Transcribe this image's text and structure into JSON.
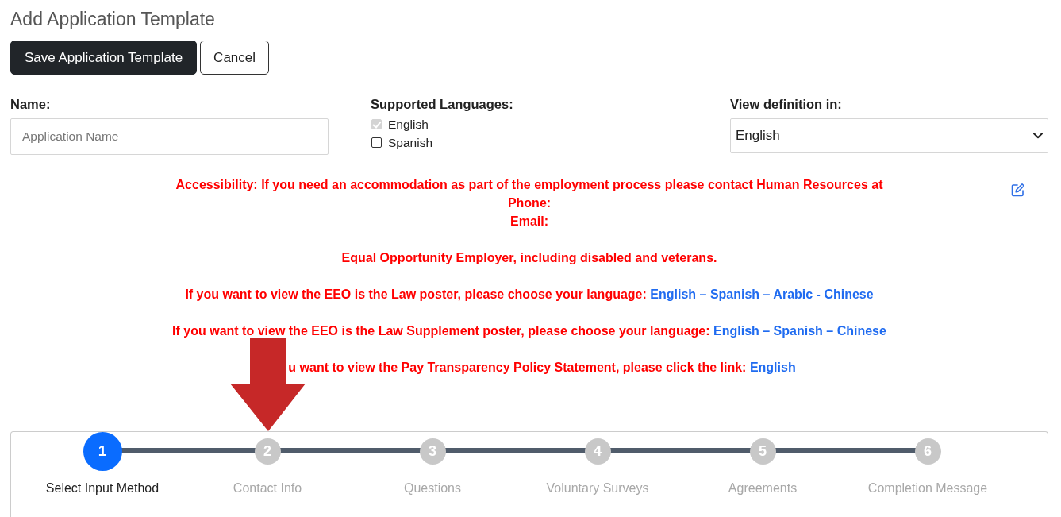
{
  "page": {
    "title": "Add Application Template"
  },
  "actions": [
    {
      "kind": "primary",
      "label": "Save Application Template"
    },
    {
      "kind": "secondary",
      "label": "Cancel"
    }
  ],
  "form": {
    "name": {
      "label": "Name:",
      "placeholder": "Application Name"
    },
    "languages": {
      "label": "Supported Languages:",
      "options": [
        {
          "label": "English",
          "checked": true,
          "disabled": true
        },
        {
          "label": "Spanish",
          "checked": false,
          "disabled": false
        }
      ]
    },
    "view_definition": {
      "label": "View definition in:",
      "value": "English"
    }
  },
  "notices": [
    {
      "lines": [
        [
          {
            "kind": "text",
            "text": "Accessibility: If you need an accommodation as part of the employment process please contact Human Resources at"
          }
        ],
        [
          {
            "kind": "text",
            "text": "Phone:"
          }
        ],
        [
          {
            "kind": "text",
            "text": "Email:"
          }
        ]
      ]
    },
    {
      "lines": [
        [
          {
            "kind": "text",
            "text": "Equal Opportunity Employer, including disabled and veterans."
          }
        ]
      ]
    },
    {
      "lines": [
        [
          {
            "kind": "text",
            "text": "If you want to view the EEO is the Law poster, please choose your language:"
          },
          {
            "kind": "link",
            "text": "English"
          },
          {
            "kind": "separator",
            "text": "–"
          },
          {
            "kind": "link",
            "text": "Spanish"
          },
          {
            "kind": "separator",
            "text": "–"
          },
          {
            "kind": "link",
            "text": "Arabic"
          },
          {
            "kind": "separator",
            "text": "-"
          },
          {
            "kind": "link",
            "text": "Chinese"
          }
        ]
      ]
    },
    {
      "lines": [
        [
          {
            "kind": "text",
            "text": "If you want to view the EEO is the Law Supplement poster, please choose your language:"
          },
          {
            "kind": "link",
            "text": "English"
          },
          {
            "kind": "separator",
            "text": "–"
          },
          {
            "kind": "link",
            "text": "Spanish"
          },
          {
            "kind": "separator",
            "text": "–"
          },
          {
            "kind": "link",
            "text": "Chinese"
          }
        ]
      ]
    },
    {
      "lines": [
        [
          {
            "kind": "text",
            "text": "u want to view the Pay Transparency Policy Statement, please click the link:"
          },
          {
            "kind": "link",
            "text": "English"
          }
        ]
      ]
    }
  ],
  "stepper": {
    "steps": [
      {
        "number": "1",
        "label": "Select Input Method",
        "selected": true
      },
      {
        "number": "2",
        "label": "Contact Info",
        "selected": false
      },
      {
        "number": "3",
        "label": "Questions",
        "selected": false
      },
      {
        "number": "4",
        "label": "Voluntary Surveys",
        "selected": false
      },
      {
        "number": "5",
        "label": "Agreements",
        "selected": false
      },
      {
        "number": "6",
        "label": "Completion Message",
        "selected": false
      }
    ]
  }
}
